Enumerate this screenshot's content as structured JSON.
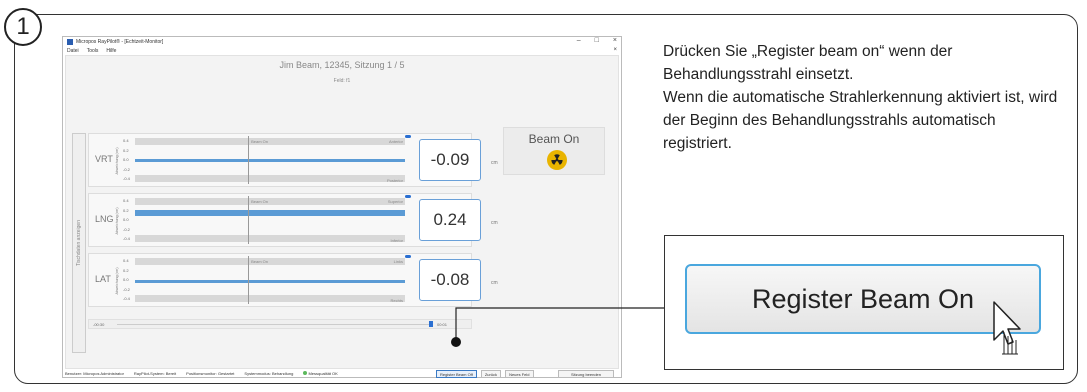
{
  "step": {
    "number": "1"
  },
  "window": {
    "title": "Micropos RayPilot® - [Echtzeit-Monitor]",
    "controls": {
      "minimize": "–",
      "maximize": "□",
      "close": "×"
    },
    "menu": [
      "Datei",
      "Tools",
      "Hilfe"
    ],
    "menu_close": "×"
  },
  "session": {
    "patient_line": "Jim Beam, 12345, Sitzung 1 / 5",
    "field": "Feld: f1"
  },
  "sidetab": {
    "label": "Tischdaten anzeigen"
  },
  "y_axis_label": "Abweichung (cm)",
  "tick_labels": [
    "0.4",
    "0.2",
    "0.0",
    "-0.2",
    "-0.4"
  ],
  "panels": [
    {
      "label": "VRT",
      "top_label": "Anterior",
      "bottom_label": "Posterior",
      "beam_label": "Beam On",
      "value": "-0.09",
      "unit": "cm"
    },
    {
      "label": "LNG",
      "top_label": "Superior",
      "bottom_label": "Inferior",
      "beam_label": "Beam On",
      "value": "0.24",
      "unit": "cm"
    },
    {
      "label": "LAT",
      "top_label": "Links",
      "bottom_label": "Rechts",
      "beam_label": "Beam On",
      "value": "-0.08",
      "unit": "cm"
    }
  ],
  "beam_status": {
    "label": "Beam On",
    "icon": "radiation-icon"
  },
  "timeline": {
    "start": "-00:30",
    "end": "00:01"
  },
  "buttons": {
    "register_beam_off": "Register Beam Off",
    "back": "Zurück",
    "new_field": "Neues Feld",
    "end_session": "Sitzung beenden"
  },
  "statusbar": {
    "user": "Benutzer: Micropos Administrator",
    "system": "RayPilot-System: Bereit",
    "positioning": "Positionsmonitor: Gestartet",
    "mode": "Systemmodus: Behandlung",
    "quality": "Messqualität OK"
  },
  "instructions": {
    "line1": "Drücken Sie „Register beam on“ wenn der Behandlungsstrahl einsetzt.",
    "line2": "Wenn die automatische Strahlerkennung aktiviert ist, wird der Beginn des Behandlungsstrahls automatisch registriert."
  },
  "zoom_button": {
    "label": "Register Beam On"
  },
  "colors": {
    "accent": "#4aa7de",
    "beam_line": "#5b9bd5",
    "radiation": "#e9b400",
    "ok": "#5cb85c"
  }
}
